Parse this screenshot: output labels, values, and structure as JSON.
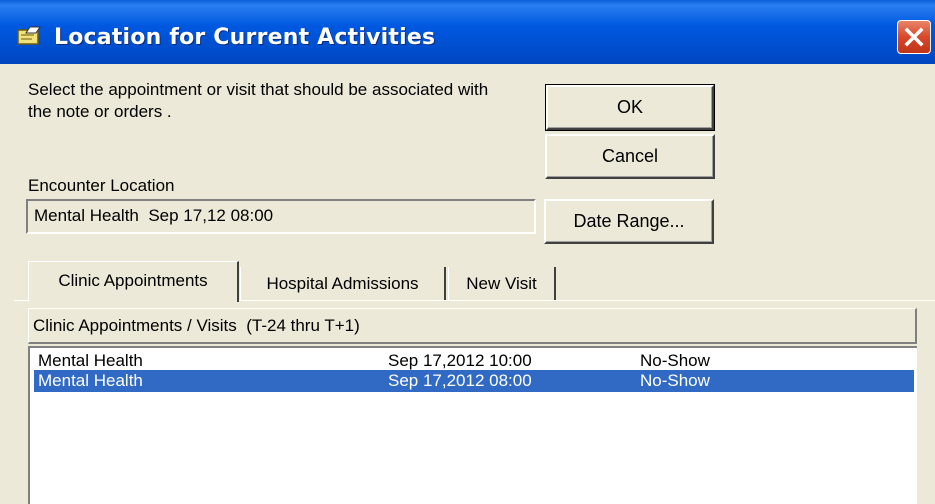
{
  "window": {
    "title": "Location for Current Activities"
  },
  "instructions": "Select the appointment or visit that should be associated with the note or orders .",
  "buttons": {
    "ok": "OK",
    "cancel": "Cancel",
    "date_range": "Date Range..."
  },
  "encounter": {
    "label": "Encounter Location",
    "value": "Mental Health  Sep 17,12 08:00"
  },
  "tabs": [
    {
      "label": "Clinic Appointments",
      "active": true
    },
    {
      "label": "Hospital Admissions",
      "active": false
    },
    {
      "label": "New Visit",
      "active": false
    }
  ],
  "grid": {
    "header": "Clinic Appointments / Visits  (T-24 thru T+1)",
    "rows": [
      {
        "location": "Mental Health",
        "datetime": "Sep 17,2012 10:00",
        "status": "No-Show",
        "selected": false
      },
      {
        "location": "Mental Health",
        "datetime": "Sep 17,2012 08:00",
        "status": "No-Show",
        "selected": true
      }
    ]
  },
  "colors": {
    "titlebar": "#0054e3",
    "selection": "#316ac5",
    "face": "#ece9d8",
    "close": "#d8482a"
  },
  "icons": {
    "title": "note-pencil-icon",
    "close": "close-icon"
  }
}
